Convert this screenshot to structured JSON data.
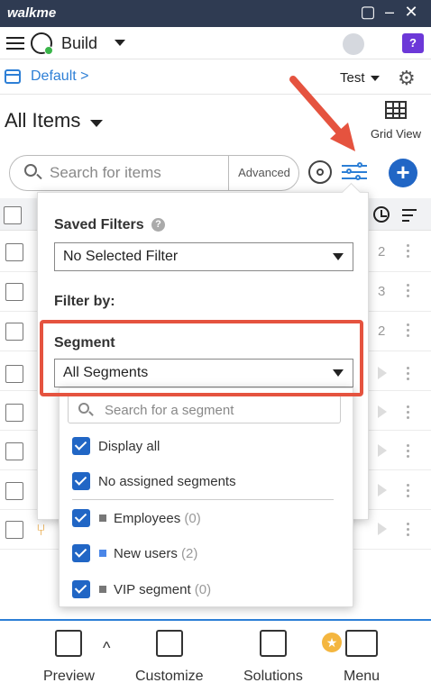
{
  "titlebar": {
    "app_name": "walkme"
  },
  "toolbar": {
    "mode_label": "Build"
  },
  "envbar": {
    "environment": "Default >",
    "test_label": "Test"
  },
  "list": {
    "title": "All Items",
    "grid_view_label": "Grid View"
  },
  "search": {
    "placeholder": "Search for items",
    "advanced_label": "Advanced"
  },
  "rows": [
    {
      "count": "2"
    },
    {
      "count": "3"
    },
    {
      "count": "2"
    },
    {
      "count": ""
    },
    {
      "count": ""
    },
    {
      "count": ""
    },
    {
      "count": ""
    },
    {
      "count": ""
    }
  ],
  "filters": {
    "saved_filters_label": "Saved Filters",
    "saved_filter_value": "No Selected Filter",
    "filter_by_label": "Filter by:",
    "segment_label": "Segment",
    "segment_value": "All Segments"
  },
  "segment_dropdown": {
    "search_placeholder": "Search for a segment",
    "options": [
      {
        "label": "Display all",
        "checked": true
      },
      {
        "label": "No assigned segments",
        "checked": true
      },
      {
        "label": "Employees",
        "count": "(0)",
        "checked": true,
        "color": "#777777"
      },
      {
        "label": "New users",
        "count": "(2)",
        "checked": true,
        "color": "#4a86e8"
      },
      {
        "label": "VIP segment",
        "count": "(0)",
        "checked": true,
        "color": "#777777"
      }
    ]
  },
  "bottom_nav": {
    "preview": "Preview",
    "customize": "Customize",
    "solutions": "Solutions",
    "menu": "Menu"
  },
  "colors": {
    "accent": "#2166c5",
    "highlight": "#e5533f",
    "titlebar": "#2f3b52"
  }
}
